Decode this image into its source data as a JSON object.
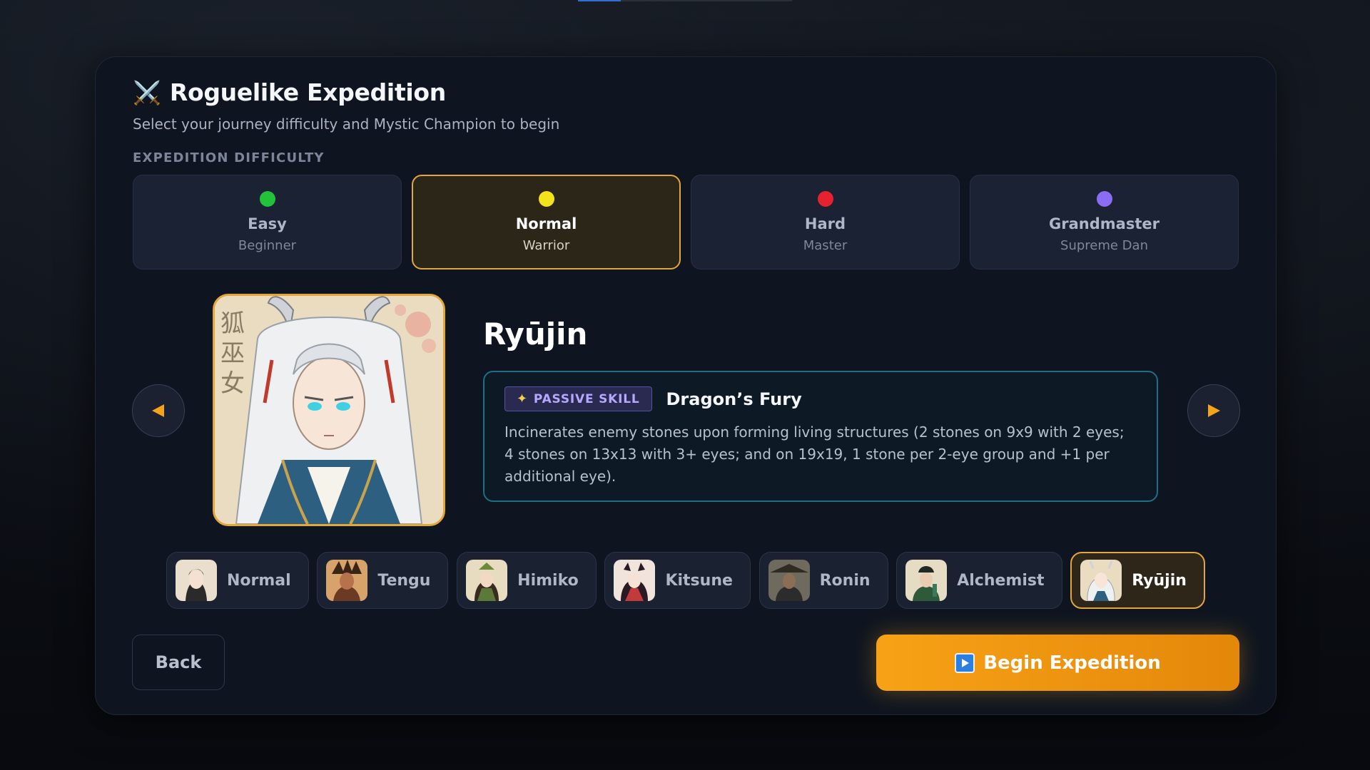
{
  "header": {
    "title": "Roguelike Expedition",
    "icon": "crossed-swords-icon",
    "subtitle": "Select your journey difficulty and Mystic Champion to begin"
  },
  "difficulty": {
    "section_label": "EXPEDITION DIFFICULTY",
    "selected": "Normal",
    "options": [
      {
        "name": "Easy",
        "sub": "Beginner",
        "color": "#22c33a"
      },
      {
        "name": "Normal",
        "sub": "Warrior",
        "color": "#f3e31b"
      },
      {
        "name": "Hard",
        "sub": "Master",
        "color": "#e5222e"
      },
      {
        "name": "Grandmaster",
        "sub": "Supreme Dan",
        "color": "#8a6df2"
      }
    ]
  },
  "champion": {
    "name": "Ryūjin",
    "portrait_text": "狐巫女",
    "skill_badge": "PASSIVE SKILL",
    "skill_name": "Dragon’s Fury",
    "skill_description": "Incinerates enemy stones upon forming living structures (2 stones on 9x9 with 2 eyes; 4 stones on 13x13 with 3+ eyes; and on 19x19, 1 stone per 2-eye group and +1 per additional eye)."
  },
  "roster": {
    "selected": "Ryūjin",
    "items": [
      {
        "label": "Normal"
      },
      {
        "label": "Tengu"
      },
      {
        "label": "Himiko"
      },
      {
        "label": "Kitsune"
      },
      {
        "label": "Ronin"
      },
      {
        "label": "Alchemist"
      },
      {
        "label": "Ryūjin"
      }
    ]
  },
  "actions": {
    "back_label": "Back",
    "begin_label": "Begin Expedition"
  },
  "colors": {
    "accent": "#e2a63a",
    "begin_gradient_start": "#f7a216",
    "begin_gradient_end": "#e4870a",
    "skill_border": "#1d6f86"
  }
}
